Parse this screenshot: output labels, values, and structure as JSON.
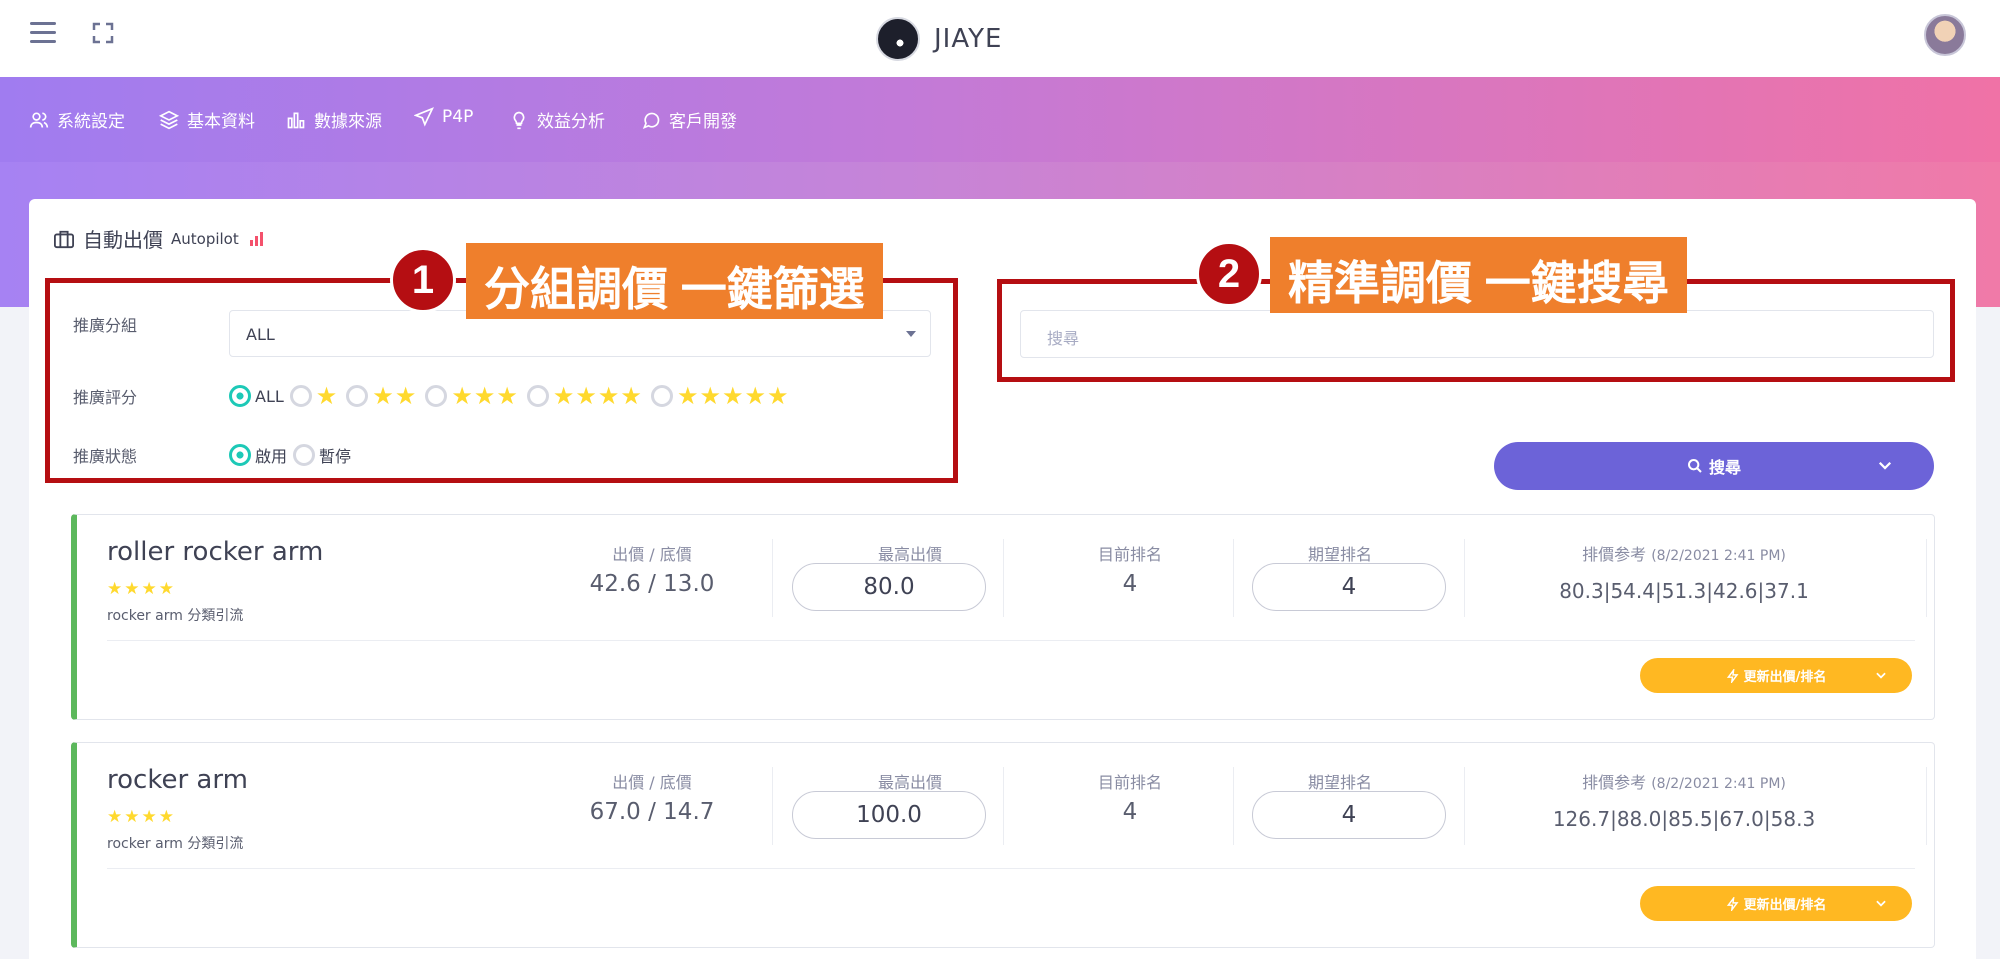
{
  "header": {
    "brand": "JIAYE"
  },
  "nav": [
    {
      "label": "系統設定",
      "icon": "users-icon"
    },
    {
      "label": "基本資料",
      "icon": "layers-icon"
    },
    {
      "label": "數據來源",
      "icon": "bar-chart-icon"
    },
    {
      "label": "P4P",
      "icon": "send-icon"
    },
    {
      "label": "效益分析",
      "icon": "lightbulb-icon"
    },
    {
      "label": "客戶開發",
      "icon": "chat-icon"
    }
  ],
  "panel": {
    "title": "自動出價",
    "subtitle": "Autopilot"
  },
  "filters": {
    "group_label": "推廣分組",
    "group_value": "ALL",
    "score_label": "推廣評分",
    "score_all": "ALL",
    "status_label": "推廣狀態",
    "status_on": "啟用",
    "status_off": "暫停"
  },
  "search": {
    "placeholder": "搜尋",
    "button": "搜尋"
  },
  "annotations": {
    "one": {
      "number": "1",
      "text": "分組調價 一鍵篩選"
    },
    "two": {
      "number": "2",
      "text": "精準調價 一鍵搜尋"
    }
  },
  "columns": {
    "bid": "出價 / 底價",
    "max_bid": "最高出價",
    "current_rank": "目前排名",
    "target_rank": "期望排名",
    "ref": "排價参考",
    "update_button": "更新出價/排名"
  },
  "products": [
    {
      "name": "roller rocker arm",
      "stars": "★★★★",
      "desc": "rocker arm 分類引流",
      "bid": "42.6 / 13.0",
      "max_bid": "80.0",
      "current_rank": "4",
      "target_rank": "4",
      "ref_date": "(8/2/2021 2:41 PM)",
      "ref_values": "80.3|54.4|51.3|42.6|37.1"
    },
    {
      "name": "rocker arm",
      "stars": "★★★★",
      "desc": "rocker arm 分類引流",
      "bid": "67.0 / 14.7",
      "max_bid": "100.0",
      "current_rank": "4",
      "target_rank": "4",
      "ref_date": "(8/2/2021 2:41 PM)",
      "ref_values": "126.7|88.0|85.5|67.0|58.3"
    }
  ],
  "colors": {
    "accent": "#6c63d8",
    "annotation": "#b50e12",
    "banner": "#ef7f2c",
    "star": "#ffd92e",
    "update": "#ffb822"
  }
}
